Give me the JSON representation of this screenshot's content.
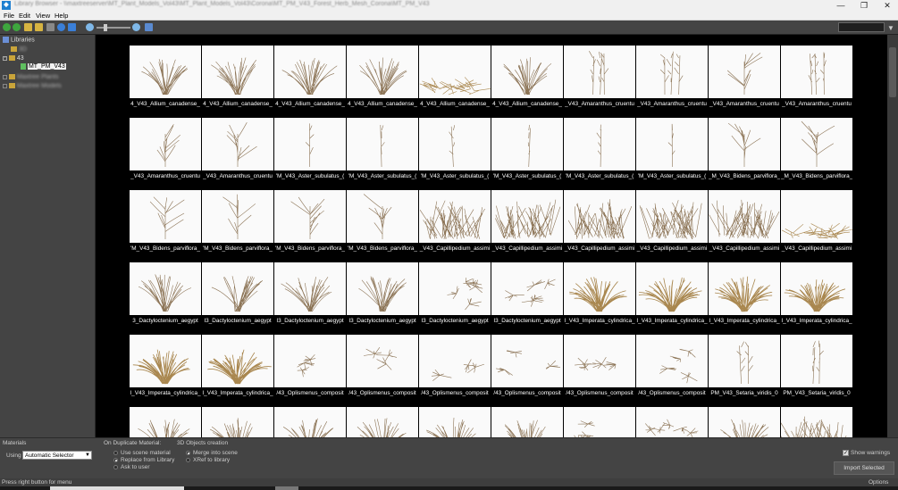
{
  "window": {
    "title": "Library Browser - \\\\maxtreeserver\\MT_Plant_Models_Vol43\\MT_Plant_Models_Vol43\\Corona\\MT_PM_V43_Forest_Herb_Mesh_Corona\\MT_PM_V43",
    "minimize": "—",
    "maximize": "❐",
    "close": "✕"
  },
  "menu": [
    "File",
    "Edit",
    "View",
    "Help"
  ],
  "toolbar": {
    "icons": [
      "back-icon",
      "forward-icon",
      "folder-open-icon",
      "folder-up-icon",
      "stop-icon",
      "refresh-icon",
      "info-icon",
      "zoom-out-icon",
      "zoom-in-icon",
      "help-icon"
    ],
    "search_value": "",
    "filter_icon": "▼"
  },
  "sidebar": {
    "root_label": "Libraries",
    "items": [
      {
        "label": "3D",
        "blurred": true
      },
      {
        "label": "43",
        "blurred": false
      },
      {
        "label": "MT_PM_V43",
        "blurred": false,
        "selected": true
      },
      {
        "label": "Maxtree Plants",
        "blurred": true
      },
      {
        "label": "Maxtree Models",
        "blurred": true
      }
    ]
  },
  "grid": {
    "rows": [
      [
        "4_V43_Allium_canadense_",
        "4_V43_Allium_canadense_",
        "4_V43_Allium_canadense_",
        "4_V43_Allium_canadense_",
        "4_V43_Allium_canadense_",
        "4_V43_Allium_canadense_",
        "_V43_Amaranthus_cruentu",
        "_V43_Amaranthus_cruentu",
        "_V43_Amaranthus_cruentu",
        "_V43_Amaranthus_cruentu"
      ],
      [
        "_V43_Amaranthus_cruentu",
        "_V43_Amaranthus_cruentu",
        "'M_V43_Aster_subulatus_(",
        "'M_V43_Aster_subulatus_(",
        "'M_V43_Aster_subulatus_(",
        "'M_V43_Aster_subulatus_(",
        "'M_V43_Aster_subulatus_(",
        "'M_V43_Aster_subulatus_(",
        "_M_V43_Bidens_parviflora_",
        "_M_V43_Bidens_parviflora_"
      ],
      [
        "'M_V43_Bidens_parviflora_",
        "'M_V43_Bidens_parviflora_",
        "'M_V43_Bidens_parviflora_",
        "'M_V43_Bidens_parviflora_",
        "_V43_Capillipedium_assimi",
        "_V43_Capillipedium_assimi",
        "_V43_Capillipedium_assimi",
        "_V43_Capillipedium_assimi",
        "_V43_Capillipedium_assimi",
        "_V43_Capillipedium_assimi"
      ],
      [
        "3_Dactyloctenium_aegypt",
        "I3_Dactyloctenium_aegypt",
        "I3_Dactyloctenium_aegypt",
        "I3_Dactyloctenium_aegypt",
        "I3_Dactyloctenium_aegypt",
        "I3_Dactyloctenium_aegypt",
        "I_V43_Imperata_cylindrica_",
        "I_V43_Imperata_cylindrica_",
        "I_V43_Imperata_cylindrica_",
        "I_V43_Imperata_cylindrica_"
      ],
      [
        "I_V43_Imperata_cylindrica_",
        "I_V43_Imperata_cylindrica_",
        "/43_Oplismenus_composit",
        "/43_Oplismenus_composit",
        "/43_Oplismenus_composit",
        "/43_Oplismenus_composit",
        "/43_Oplismenus_composit",
        "/43_Oplismenus_composit",
        "PM_V43_Setaria_viridis_0",
        "PM_V43_Setaria_viridis_0"
      ],
      [
        "",
        "",
        "",
        "",
        "",
        "",
        "",
        "",
        "",
        ""
      ]
    ],
    "kinds": [
      [
        "grass",
        "grass",
        "grass",
        "grass",
        "mat",
        "grass",
        "stalk",
        "stalk",
        "branch",
        "stalk"
      ],
      [
        "branch",
        "branch",
        "stalk",
        "stalk",
        "stalk",
        "stalk",
        "stalk",
        "stalk",
        "branch",
        "branch"
      ],
      [
        "branch",
        "branch",
        "branch",
        "branch",
        "bush",
        "bush",
        "bush",
        "bush",
        "bush",
        "mat"
      ],
      [
        "grass",
        "grass",
        "grass",
        "grass",
        "spread",
        "spread",
        "tuft",
        "tuft",
        "tuft",
        "tuft"
      ],
      [
        "tuft",
        "tuft",
        "spread",
        "spread",
        "spread",
        "spread",
        "spread",
        "spread",
        "stalk",
        "stalk"
      ],
      [
        "grass",
        "grass",
        "grass",
        "grass",
        "grass",
        "grass",
        "spread",
        "spread",
        "grass",
        "bush"
      ]
    ]
  },
  "bottom": {
    "materials_label": "Materials",
    "using_label": "Using",
    "using_value": "Automatic Selector",
    "duplicate_label": "On Duplicate Material:",
    "duplicate_options": [
      "Use scene material",
      "Replace from Library",
      "Ask to user"
    ],
    "duplicate_selected": 1,
    "creation_label": "3D Objects creation",
    "creation_options": [
      "Merge into scene",
      "XRef to library"
    ],
    "creation_selected": 0,
    "show_warnings_label": "Show warnings",
    "show_warnings_checked": "✓",
    "import_label": "Import Selected"
  },
  "status": {
    "text": "Press right button for menu",
    "options": "Options"
  }
}
